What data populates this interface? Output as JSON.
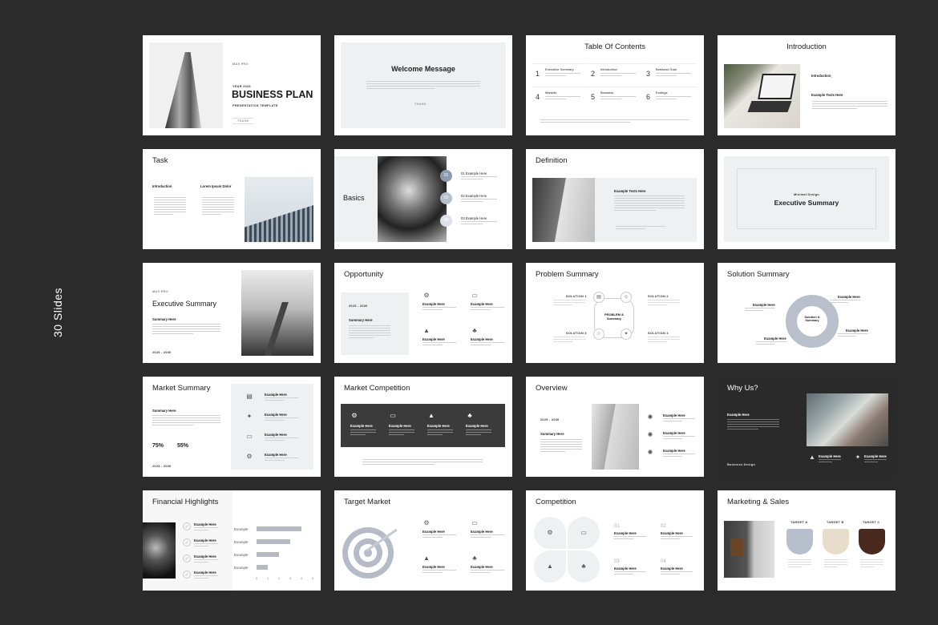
{
  "side_label": "30 Slides",
  "colors": {
    "background": "#2b2b2b",
    "accent_gray": "#8e9ab0",
    "target_a": "#b8bfcc",
    "target_b": "#e8dccb",
    "target_c": "#4a2a1e"
  },
  "s1": {
    "brand": "MAX PRO",
    "year": "YEAR 2025",
    "title": "BUSINESS PLAN",
    "subtitle": "PRESENTATION TEMPLATE",
    "button": "THANK"
  },
  "s2": {
    "title": "Welcome Message",
    "button": "THANK"
  },
  "s3": {
    "title": "Table Of Contents",
    "items": [
      {
        "n": "1",
        "label": "Executive Summary"
      },
      {
        "n": "2",
        "label": "Introduction"
      },
      {
        "n": "3",
        "label": "Business Goal"
      },
      {
        "n": "4",
        "label": "Markets"
      },
      {
        "n": "5",
        "label": "Business"
      },
      {
        "n": "6",
        "label": "Endings"
      }
    ]
  },
  "s4": {
    "title": "Introduction",
    "sub": "Introduction_",
    "heading": "Example Texts Here"
  },
  "s5": {
    "title": "Task",
    "col1": "Introduction",
    "col2": "Lorem Ipsum Dolor"
  },
  "s6": {
    "title": "Basics",
    "items": [
      {
        "n": "01",
        "label": "01 Example Here"
      },
      {
        "n": "02",
        "label": "02 Example Here"
      },
      {
        "n": "03",
        "label": "03 Example Here"
      }
    ]
  },
  "s7": {
    "title": "Definition",
    "heading": "Example Texts Here"
  },
  "s8": {
    "kicker": "Minimal Design",
    "title": "Executive Summary"
  },
  "s9": {
    "brand": "MAX PRO",
    "title": "Executive Summary",
    "heading": "Summary Here",
    "years": "2025 - 2030"
  },
  "s10": {
    "title": "Opportunity",
    "years": "2025 - 2030",
    "heading": "Summary Here",
    "item": "Example Here"
  },
  "s11": {
    "title": "Problem Summary",
    "center": "PROBLEM & Summary",
    "solutions": [
      "SOLUTION 1",
      "SOLUTION 2",
      "SOLUTION 3",
      "SOLUTION 4"
    ]
  },
  "s12": {
    "title": "Solution Summary",
    "center": "Solution & Summary",
    "item": "Example Here"
  },
  "s13": {
    "title": "Market Summary",
    "heading": "Summary Here",
    "stat1": "75%",
    "stat2": "55%",
    "years": "2025 - 2030",
    "item": "Example Here"
  },
  "s14": {
    "title": "Market Competition",
    "item": "Example Here"
  },
  "s15": {
    "title": "Overview",
    "years": "2025 - 2030",
    "heading": "Summary Here",
    "item": "Example Here"
  },
  "s16": {
    "title": "Why Us?",
    "heading": "Example Here",
    "footer": "Business Design",
    "item": "Example Here"
  },
  "s17": {
    "title": "Financial Highlights",
    "item": "Example Here",
    "chart_data": {
      "type": "bar",
      "orientation": "horizontal",
      "categories": [
        "Example",
        "Example",
        "Example",
        "Example"
      ],
      "values": [
        4,
        3,
        2,
        1
      ],
      "xlim": [
        0,
        5
      ],
      "ticks": [
        "0",
        "1",
        "2",
        "3",
        "4",
        "5"
      ]
    }
  },
  "s18": {
    "title": "Target Market",
    "item": "Example Here"
  },
  "s19": {
    "title": "Competition",
    "items": [
      {
        "n": "01",
        "label": "Example Here"
      },
      {
        "n": "02",
        "label": "Example Here"
      },
      {
        "n": "03",
        "label": "Example Here"
      },
      {
        "n": "04",
        "label": "Example Here"
      }
    ]
  },
  "s20": {
    "title": "Marketing & Sales",
    "targets": [
      "TARGET A",
      "TARGET B",
      "TARGET C"
    ]
  }
}
